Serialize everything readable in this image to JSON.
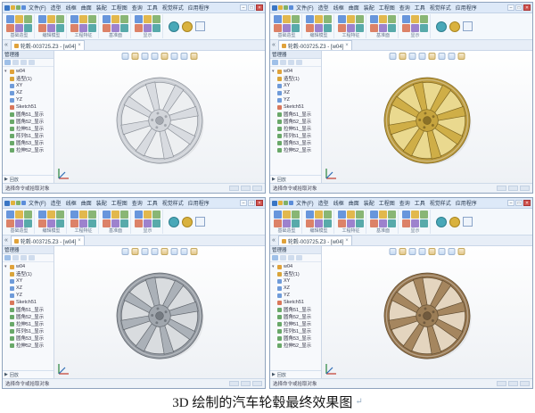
{
  "caption": {
    "text": "3D 绘制的汽车轮毂最终效果图",
    "mark": "↵"
  },
  "colors": {
    "titlebar_bg": "#dde9f8",
    "ribbon_bg": "#f4f8fc",
    "tabbar_bg": "#e7eef7",
    "panel_border": "#8fa3bd",
    "tree_bg": "#f7f9fc",
    "viewport_top": "#ffffff",
    "viewport_bottom": "#eef1f5",
    "status_bg": "#edf2f8",
    "accent": "#3a76c4"
  },
  "app": {
    "menu_items": [
      "文件(F)",
      "造型",
      "线框",
      "曲面",
      "装配",
      "工程图",
      "查询",
      "工具",
      "视觉样式",
      "应用程序"
    ],
    "window_controls": {
      "minimize": "–",
      "maximize": "□",
      "close": "×"
    },
    "ribbon_groups": [
      {
        "label": "基础造型"
      },
      {
        "label": "编辑模型"
      },
      {
        "label": "工程特征"
      },
      {
        "label": "基准面"
      },
      {
        "label": "显示"
      }
    ],
    "doc_tab": {
      "nav": "«",
      "title": "轮毂-003725.Z3 - [w04]",
      "close": "×"
    },
    "manager": {
      "title": "管理器"
    },
    "tree": {
      "expander": "▾",
      "root": "w04",
      "items": [
        "造型(1)",
        "XY",
        "XZ",
        "YZ",
        "Sketch51",
        "圆角51_显示",
        "圆角52_显示",
        "拉伸51_显示",
        "阵列51_显示",
        "圆角53_显示",
        "拉伸52_显示"
      ],
      "footer_glyph": "▶",
      "footer_label": "回放"
    },
    "status": {
      "prompt": "选择命令或拾取对象"
    }
  },
  "panels": [
    {
      "name": "wheel-silver",
      "wheel": {
        "rim": "#c9cdd3",
        "dish": "#edeff1",
        "spoke": "#d8dbe0",
        "edge": "#8b9098",
        "hub": "#d2d5da",
        "center": "#a3a7ae"
      }
    },
    {
      "name": "wheel-gold",
      "wheel": {
        "rim": "#b9983c",
        "dish": "#ead98f",
        "spoke": "#cfae47",
        "edge": "#7e6620",
        "hub": "#c6a43e",
        "center": "#8b7127"
      }
    },
    {
      "name": "wheel-steel",
      "wheel": {
        "rim": "#9298a0",
        "dish": "#d9dcdf",
        "spoke": "#abb1b8",
        "edge": "#62676e",
        "hub": "#a0a6ad",
        "center": "#747a81"
      }
    },
    {
      "name": "wheel-bronze",
      "wheel": {
        "rim": "#93734c",
        "dish": "#e4d5bf",
        "spoke": "#a5865f",
        "edge": "#604c31",
        "hub": "#9b7d56",
        "center": "#705a3e"
      }
    }
  ]
}
